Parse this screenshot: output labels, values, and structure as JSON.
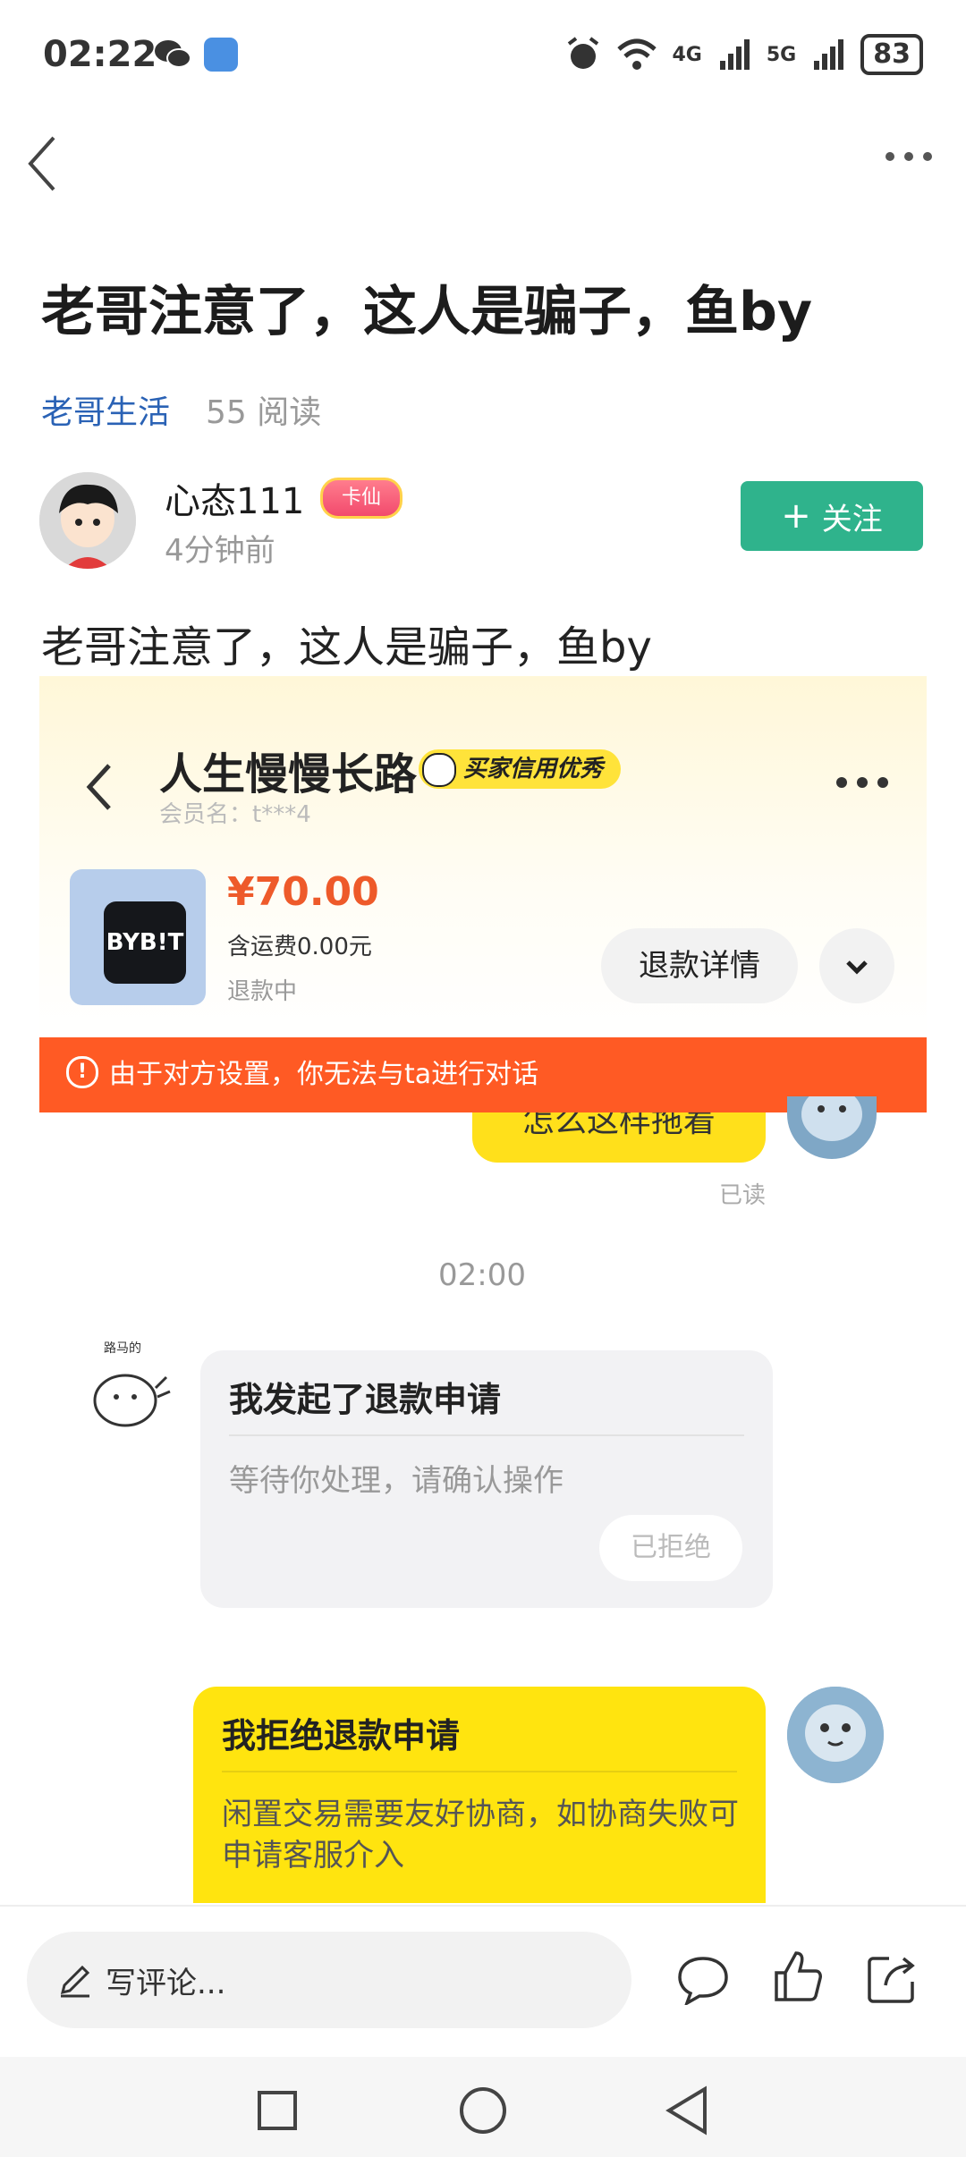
{
  "status_bar": {
    "time": "02:22",
    "network": "4G",
    "network2": "5G",
    "battery": "83"
  },
  "post": {
    "title": "老哥注意了，这人是骗子，鱼by",
    "channel": "老哥生活",
    "reads": "55 阅读",
    "author": "心态111",
    "badge": "卡仙",
    "posted_time": "4分钟前",
    "follow_label": "关注",
    "body": "老哥注意了，这人是骗子，鱼by"
  },
  "screenshot": {
    "seller_name": "人生慢慢长路",
    "credit_badge": "买家信用优秀",
    "member": "会员名：t***4",
    "product_logo": "BYB!T",
    "price": "¥70.00",
    "shipping": "含运费0.00元",
    "status": "退款中",
    "refund_detail": "退款详情",
    "banner": "由于对方设置，你无法与ta进行对话",
    "banner_icon": "!",
    "bubble_partial": "怎么这样拖着",
    "read_label": "已读",
    "time": "02:00",
    "card1": {
      "title": "我发起了退款申请",
      "desc": "等待你处理，请确认操作",
      "status": "已拒绝"
    },
    "card2": {
      "title": "我拒绝退款申请",
      "desc": "闲置交易需要友好协商，如协商失败可申请客服介入"
    }
  },
  "bottom_bar": {
    "comment_placeholder": "写评论..."
  },
  "icons": [
    "back-icon",
    "more-icon",
    "wechat-icon",
    "message-icon",
    "alarm-icon",
    "wifi-icon",
    "signal-icon",
    "battery-icon",
    "pencil-icon",
    "comment-icon",
    "like-icon",
    "share-icon"
  ]
}
